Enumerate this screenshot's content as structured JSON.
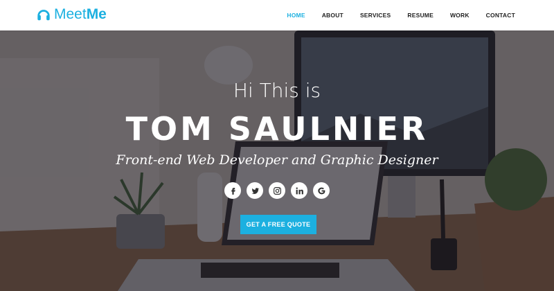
{
  "brand": {
    "name_regular": "Meet",
    "name_bold": "Me",
    "color": "#1cb0e0"
  },
  "nav": {
    "items": [
      {
        "label": "HOME",
        "active": true
      },
      {
        "label": "ABOUT",
        "active": false
      },
      {
        "label": "SERVICES",
        "active": false
      },
      {
        "label": "RESUME",
        "active": false
      },
      {
        "label": "WORK",
        "active": false
      },
      {
        "label": "CONTACT",
        "active": false
      }
    ]
  },
  "hero": {
    "greeting": "Hi This is",
    "name": "TOM SAULNIER",
    "role": "Front-end Web Developer and Graphic Designer",
    "socials": [
      {
        "icon": "facebook-icon"
      },
      {
        "icon": "twitter-icon"
      },
      {
        "icon": "instagram-icon"
      },
      {
        "icon": "linkedin-icon"
      },
      {
        "icon": "google-icon"
      }
    ],
    "cta_label": "GET A FREE QUOTE"
  }
}
